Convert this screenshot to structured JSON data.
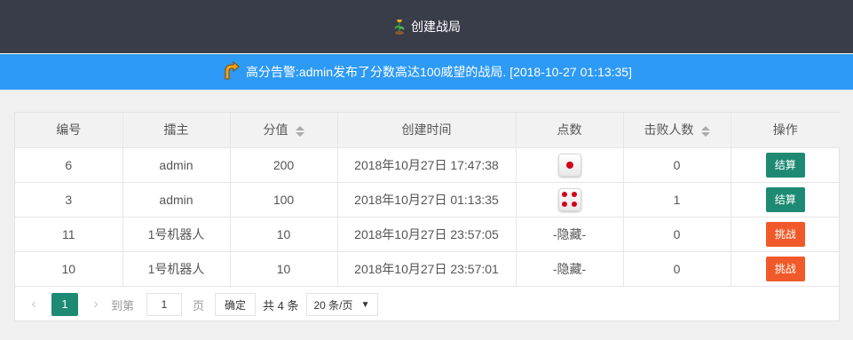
{
  "header": {
    "create_label": "创建战局"
  },
  "notice": {
    "text": "高分告警:admin发布了分数高达100威望的战局. [2018-10-27 01:13:35]"
  },
  "table": {
    "columns": [
      "编号",
      "擂主",
      "分值",
      "创建时间",
      "点数",
      "击败人数",
      "操作"
    ],
    "sortable_columns": [
      "分值",
      "击败人数"
    ],
    "rows": [
      {
        "id": "6",
        "host": "admin",
        "score": "200",
        "time": "2018年10月27日 17:47:38",
        "points": 1,
        "points_text": "",
        "defeated": "0",
        "action": "结算",
        "action_type": "settle"
      },
      {
        "id": "3",
        "host": "admin",
        "score": "100",
        "time": "2018年10月27日 01:13:35",
        "points": 4,
        "points_text": "",
        "defeated": "1",
        "action": "结算",
        "action_type": "settle"
      },
      {
        "id": "11",
        "host": "1号机器人",
        "score": "10",
        "time": "2018年10月27日 23:57:05",
        "points": null,
        "points_text": "-隐藏-",
        "defeated": "0",
        "action": "挑战",
        "action_type": "challenge"
      },
      {
        "id": "10",
        "host": "1号机器人",
        "score": "10",
        "time": "2018年10月27日 23:57:01",
        "points": null,
        "points_text": "-隐藏-",
        "defeated": "0",
        "action": "挑战",
        "action_type": "challenge"
      }
    ]
  },
  "pager": {
    "prev": "<",
    "next": ">",
    "current_page": "1",
    "goto_label": "到第",
    "goto_value": "1",
    "page_unit": "页",
    "confirm_label": "确定",
    "total_label": "共 4 条",
    "page_size": "20 条/页"
  },
  "colors": {
    "topbar": "#393d49",
    "notice": "#2d9af5",
    "settle": "#1e8a73",
    "challenge": "#f05a2a",
    "dice_pip": "#d0021b"
  }
}
